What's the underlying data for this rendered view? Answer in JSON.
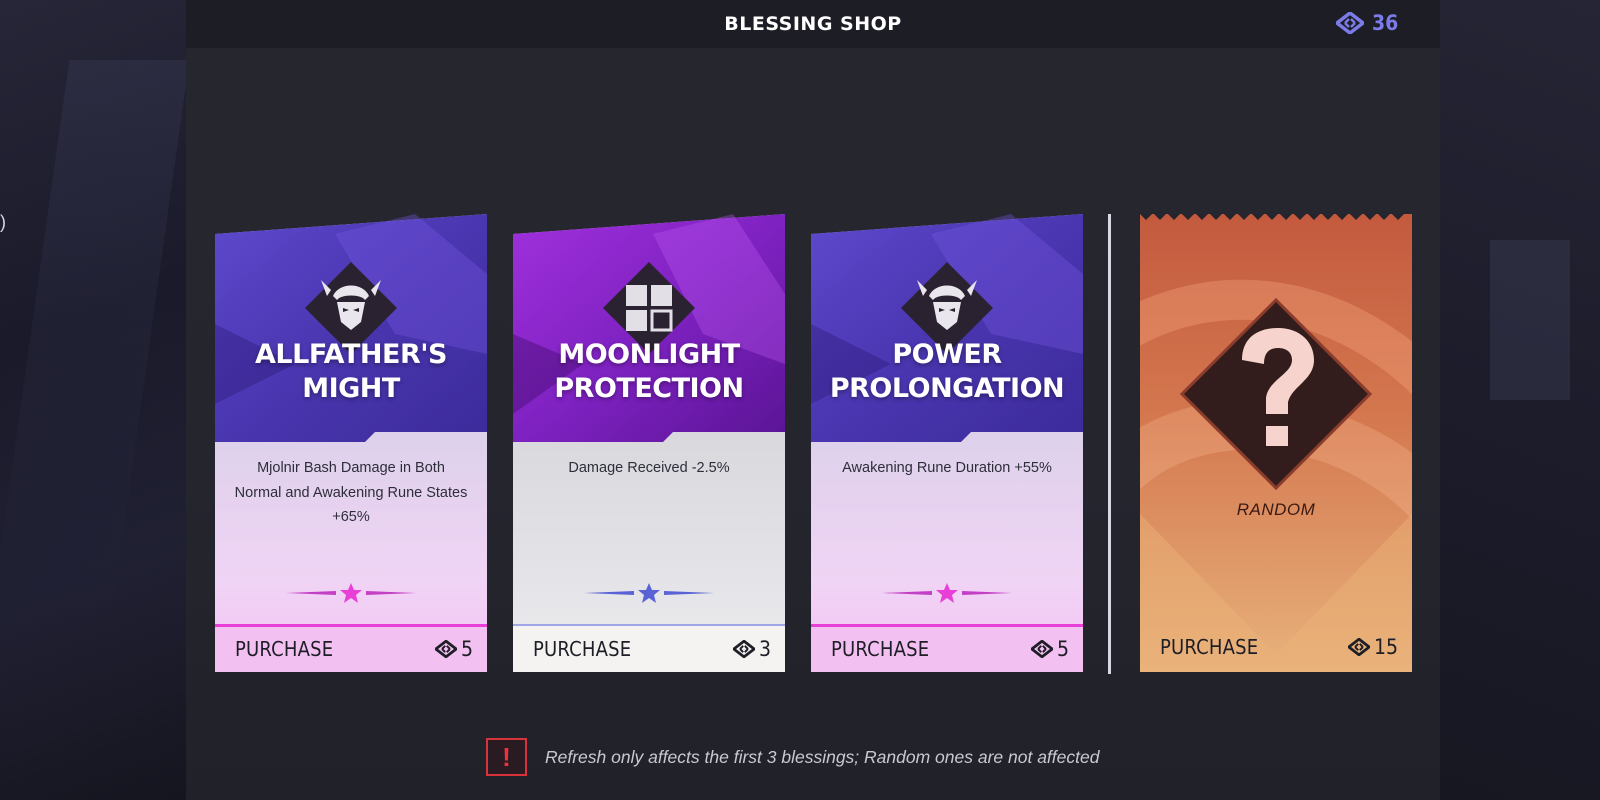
{
  "header": {
    "title": "BLESSING SHOP",
    "currency": "36"
  },
  "cards": [
    {
      "title_line1": "ALLFATHER'S",
      "title_line2": "MIGHT",
      "description": "Mjolnir Bash Damage in Both Normal and Awakening Rune States +65%",
      "purchase_label": "PURCHASE",
      "price": "5",
      "icon": "thor-helmet-icon"
    },
    {
      "title_line1": "MOONLIGHT",
      "title_line2": "PROTECTION",
      "description": "Damage Received -2.5%",
      "purchase_label": "PURCHASE",
      "price": "3",
      "icon": "grid-shield-icon"
    },
    {
      "title_line1": "POWER",
      "title_line2": "PROLONGATION",
      "description": "Awakening Rune Duration +55%",
      "purchase_label": "PURCHASE",
      "price": "5",
      "icon": "thor-helmet-icon"
    }
  ],
  "random_card": {
    "label": "RANDOM",
    "purchase_label": "PURCHASE",
    "price": "15",
    "icon": "question-mark-icon"
  },
  "notice": {
    "icon": "exclamation-icon",
    "text": "Refresh only affects the first 3 blessings; Random ones are not affected"
  },
  "colors": {
    "currency_accent": "#7b7be8",
    "epic_accent": "#e83fd7",
    "rare_accent": "#5a63d6",
    "notice_red": "#d8323a"
  }
}
